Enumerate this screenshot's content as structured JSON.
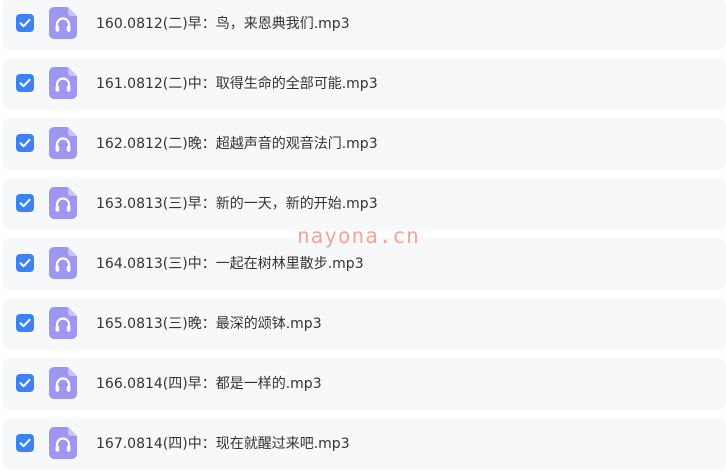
{
  "colors": {
    "accent": "#3b82f6",
    "row_background": "#f7f8fa",
    "audio_icon": "#9c98f2",
    "watermark": "#f3a59f"
  },
  "files": [
    {
      "name": "160.0812(二)早：鸟，来恩典我们.mp3",
      "checked": true,
      "icon": "audio-file-icon"
    },
    {
      "name": "161.0812(二)中：取得生命的全部可能.mp3",
      "checked": true,
      "icon": "audio-file-icon"
    },
    {
      "name": "162.0812(二)晚：超越声音的观音法门.mp3",
      "checked": true,
      "icon": "audio-file-icon"
    },
    {
      "name": "163.0813(三)早：新的一天，新的开始.mp3",
      "checked": true,
      "icon": "audio-file-icon"
    },
    {
      "name": "164.0813(三)中：一起在树林里散步.mp3",
      "checked": true,
      "icon": "audio-file-icon"
    },
    {
      "name": "165.0813(三)晚：最深的颂钵.mp3",
      "checked": true,
      "icon": "audio-file-icon"
    },
    {
      "name": "166.0814(四)早：都是一样的.mp3",
      "checked": true,
      "icon": "audio-file-icon"
    },
    {
      "name": "167.0814(四)中：现在就醒过来吧.mp3",
      "checked": true,
      "icon": "audio-file-icon"
    }
  ],
  "watermark": {
    "text": "nayona.cn"
  }
}
